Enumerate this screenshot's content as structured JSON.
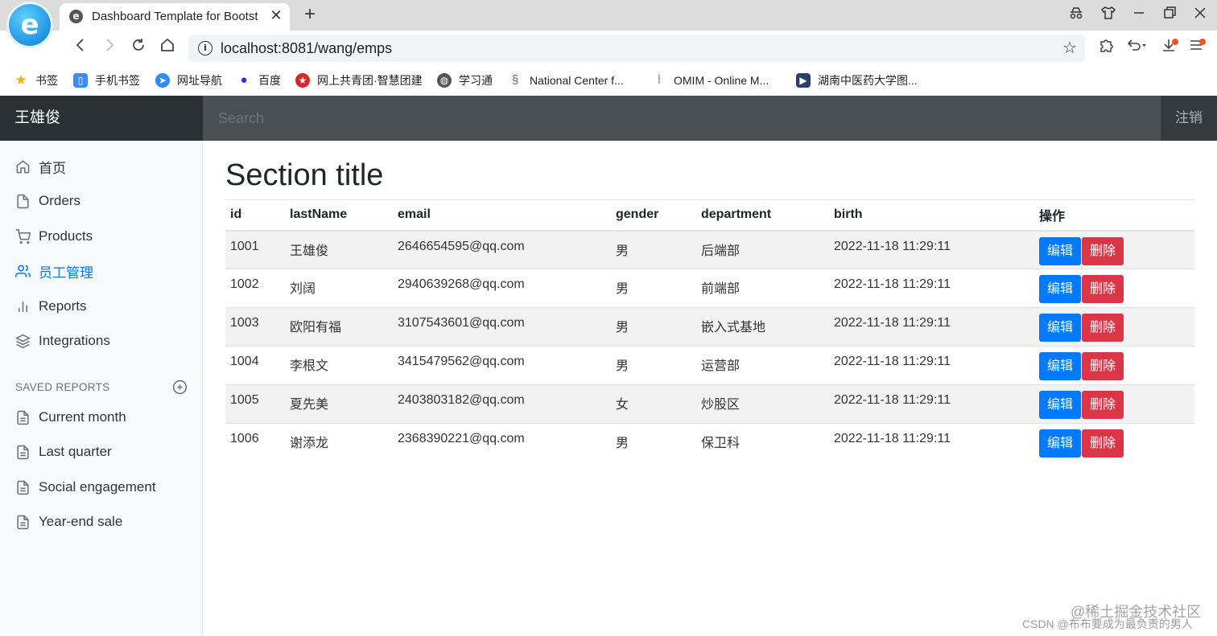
{
  "browser": {
    "tab_title": "Dashboard Template for Bootst",
    "tab_close": "✕",
    "new_tab": "+",
    "url": "localhost:8081/wang/emps",
    "bookmarks": [
      {
        "label": "书签",
        "icon": "star-icon",
        "color": "#f5b400"
      },
      {
        "label": "手机书签",
        "icon": "phone-icon",
        "color": "#3b8cf0"
      },
      {
        "label": "网址导航",
        "icon": "navigation-icon",
        "color": "#2d8cf0"
      },
      {
        "label": "百度",
        "icon": "baidu-paw-icon",
        "color": "#2932e1"
      },
      {
        "label": "网上共青团·智慧团建",
        "icon": "youth-league-icon",
        "color": "#d8262c"
      },
      {
        "label": "学习通",
        "icon": "globe-icon",
        "color": "#555555"
      },
      {
        "label": "National Center f...",
        "icon": "ncbi-icon",
        "color": "#4f6a8f"
      },
      {
        "label": "OMIM - Online M...",
        "icon": "dna-icon",
        "color": "#3b4ea3"
      },
      {
        "label": "湖南中医药大学图...",
        "icon": "library-icon",
        "color": "#2c3e6b"
      }
    ]
  },
  "navbar": {
    "brand": "王雄俊",
    "search_placeholder": "Search",
    "signout": "注销"
  },
  "sidebar": {
    "items": [
      {
        "label": "首页",
        "icon": "home-icon"
      },
      {
        "label": "Orders",
        "icon": "file-icon"
      },
      {
        "label": "Products",
        "icon": "shopping-cart-icon"
      },
      {
        "label": "员工管理",
        "icon": "users-icon",
        "active": true
      },
      {
        "label": "Reports",
        "icon": "bar-chart-icon"
      },
      {
        "label": "Integrations",
        "icon": "layers-icon"
      }
    ],
    "saved_heading": "SAVED REPORTS",
    "saved_items": [
      {
        "label": "Current month",
        "icon": "file-text-icon"
      },
      {
        "label": "Last quarter",
        "icon": "file-text-icon"
      },
      {
        "label": "Social engagement",
        "icon": "file-text-icon"
      },
      {
        "label": "Year-end sale",
        "icon": "file-text-icon"
      }
    ]
  },
  "main": {
    "title": "Section title",
    "table": {
      "headers": [
        "id",
        "lastName",
        "email",
        "gender",
        "department",
        "birth",
        "操作"
      ],
      "rows": [
        [
          "1001",
          "王雄俊",
          "2646654595@qq.com",
          "男",
          "后端部",
          "2022-11-18 11:29:11"
        ],
        [
          "1002",
          "刘阔",
          "2940639268@qq.com",
          "男",
          "前端部",
          "2022-11-18 11:29:11"
        ],
        [
          "1003",
          "欧阳有福",
          "3107543601@qq.com",
          "男",
          "嵌入式基地",
          "2022-11-18 11:29:11"
        ],
        [
          "1004",
          "李根文",
          "3415479562@qq.com",
          "男",
          "运营部",
          "2022-11-18 11:29:11"
        ],
        [
          "1005",
          "夏先美",
          "2403803182@qq.com",
          "女",
          "炒股区",
          "2022-11-18 11:29:11"
        ],
        [
          "1006",
          "谢添龙",
          "2368390221@qq.com",
          "男",
          "保卫科",
          "2022-11-18 11:29:11"
        ]
      ],
      "edit_label": "编辑",
      "delete_label": "删除"
    }
  },
  "watermarks": {
    "line1": "@稀土掘金技术社区",
    "line2": "CSDN @布布要成为最负责的男人"
  }
}
